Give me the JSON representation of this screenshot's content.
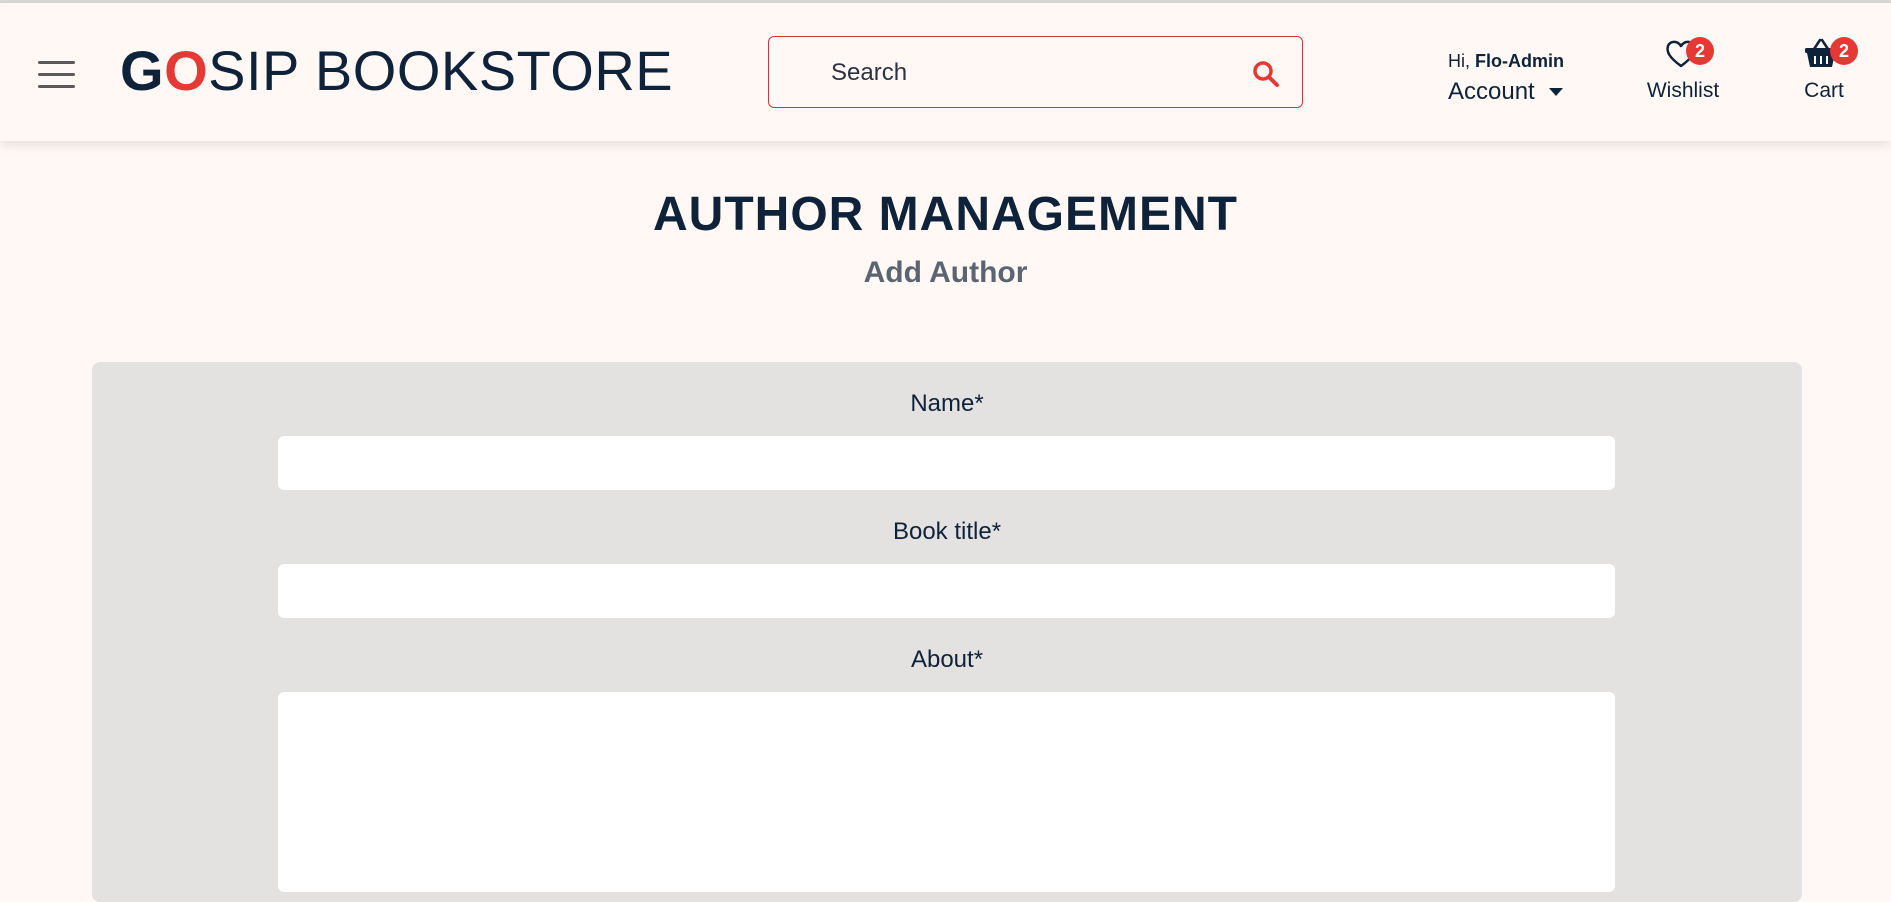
{
  "header": {
    "brand": {
      "g": "G",
      "o": "O",
      "rest": "SIP BOOKSTORE"
    },
    "search": {
      "placeholder": "Search"
    },
    "account": {
      "greeting_prefix": "Hi, ",
      "username": "Flo-Admin",
      "label": "Account"
    },
    "wishlist": {
      "label": "Wishlist",
      "count": "2"
    },
    "cart": {
      "label": "Cart",
      "count": "2"
    }
  },
  "page": {
    "title": "AUTHOR MANAGEMENT",
    "subtitle": "Add Author"
  },
  "form": {
    "name_label": "Name*",
    "name_value": "",
    "book_title_label": "Book title*",
    "book_title_value": "",
    "about_label": "About*",
    "about_value": ""
  },
  "colors": {
    "accent": "#e53935",
    "navy": "#0e2239",
    "background": "#fff8f5",
    "card": "#e3e2e0"
  }
}
